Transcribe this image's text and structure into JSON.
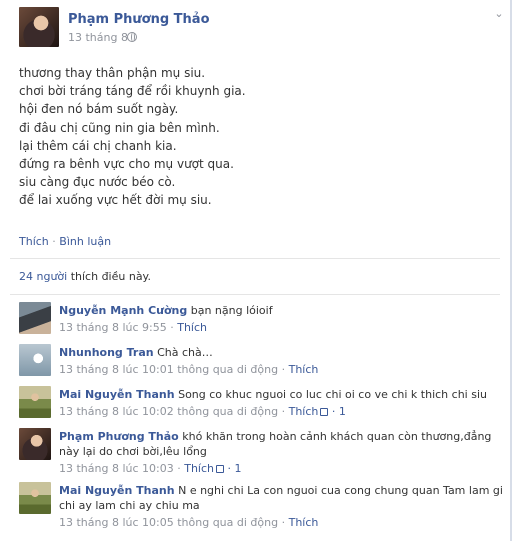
{
  "post": {
    "author": "Phạm Phương Thảo",
    "date": "13 tháng 8",
    "lines": [
      "thương thay thân phận mụ siu.",
      "chơi bời tráng táng để rồi khuynh gia.",
      "hội đen nó bám suốt ngày.",
      "đi đâu chị cũng nin gia bên mình.",
      "lại thêm cái chị chanh kia.",
      "đứng ra bênh vực cho mụ vượt qua.",
      "siu càng đục nước béo cò.",
      "để lai xuống vực hết đời mụ siu."
    ],
    "actions": {
      "like": "Thích",
      "separator": "·",
      "comment": "Bình luận"
    },
    "likes_summary": {
      "count": "24 người",
      "text": " thích điều này."
    }
  },
  "comments": [
    {
      "author": "Nguyễn Mạnh Cường",
      "text": "bạn nặng lóioif",
      "meta": "13 tháng 8 lúc 9:55 · ",
      "like": "Thích",
      "likes": ""
    },
    {
      "author": "Nhunhong Tran",
      "text": "Chà chà…",
      "meta": "13 tháng 8 lúc 10:01 thông qua di động · ",
      "like": "Thích",
      "likes": ""
    },
    {
      "author": "Mai Nguyễn Thanh",
      "text": "Song co khuc nguoi co luc chi oi co ve chi k thich chi siu",
      "meta": "13 tháng 8 lúc 10:02 thông qua di động · ",
      "like": "Thích",
      "likes": " · 1"
    },
    {
      "author": "Phạm Phương Thảo",
      "text": "khó khăn trong hoàn cảnh khách quan còn thương,đẳng này lại do chơi bời,lêu lổng",
      "meta": "13 tháng 8 lúc 10:03 · ",
      "like": "Thích",
      "likes": " · 1"
    },
    {
      "author": "Mai Nguyễn Thanh",
      "text": "N e nghi chi La con nguoi cua cong chung quan Tam lam gi chi ay lam chi ay chiu ma",
      "meta": "13 tháng 8 lúc 10:05 thông qua di động · ",
      "like": "Thích",
      "likes": ""
    }
  ]
}
